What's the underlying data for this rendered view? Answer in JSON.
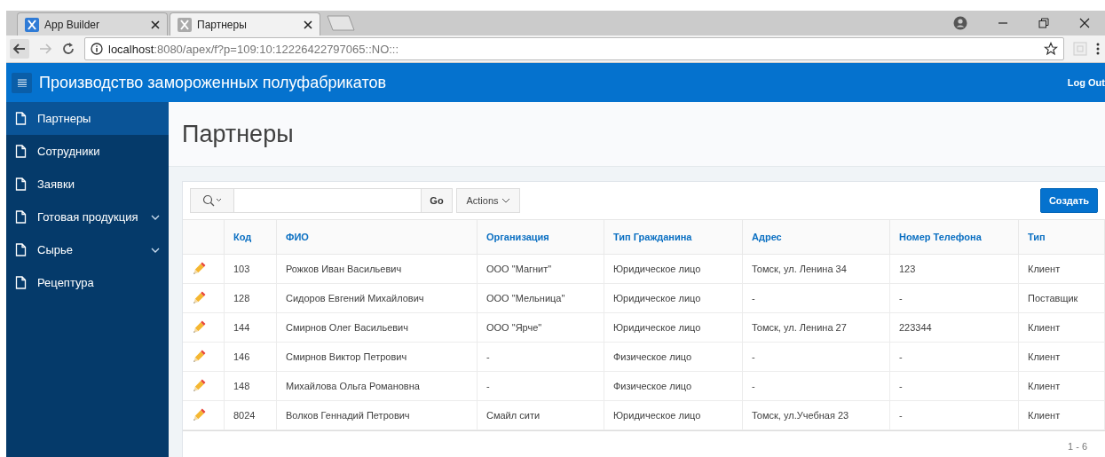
{
  "browser": {
    "tabs": [
      {
        "title": "App Builder",
        "selected": false
      },
      {
        "title": "Партнеры",
        "selected": true
      }
    ],
    "url": {
      "host": "localhost",
      "rest": ":8080/apex/f?p=109:10:12226422797065::NO:::"
    }
  },
  "app": {
    "title": "Производство замороженных полуфабрикатов",
    "logout": "Log Out"
  },
  "sidebar": {
    "items": [
      {
        "label": "Партнеры",
        "selected": true,
        "has_children": false
      },
      {
        "label": "Сотрудники",
        "selected": false,
        "has_children": false
      },
      {
        "label": "Заявки",
        "selected": false,
        "has_children": false
      },
      {
        "label": "Готовая продукция",
        "selected": false,
        "has_children": true
      },
      {
        "label": "Сырье",
        "selected": false,
        "has_children": true
      },
      {
        "label": "Рецептура",
        "selected": false,
        "has_children": false
      }
    ]
  },
  "page": {
    "title": "Партнеры"
  },
  "toolbar": {
    "go": "Go",
    "actions": "Actions",
    "create": "Создать"
  },
  "table": {
    "columns": [
      "Код",
      "ФИО",
      "Организация",
      "Тип Гражданина",
      "Адрес",
      "Номер Телефона",
      "Тип"
    ],
    "rows": [
      [
        "103",
        "Рожков Иван Васильевич",
        "ООО \"Магнит\"",
        "Юридическое лицо",
        "Томск, ул. Ленина 34",
        "123",
        "Клиент"
      ],
      [
        "128",
        "Сидоров Евгений Михайлович",
        "ООО \"Мельница\"",
        "Юридическое лицо",
        "-",
        "-",
        "Поставщик"
      ],
      [
        "144",
        "Смирнов Олег Васильевич",
        "ООО \"Ярче\"",
        "Юридическое лицо",
        "Томск, ул. Ленина 27",
        "223344",
        "Клиент"
      ],
      [
        "146",
        "Смирнов Виктор Петрович",
        "-",
        "Физическое лицо",
        "-",
        "-",
        "Клиент"
      ],
      [
        "148",
        "Михайлова Ольга Романовна",
        "-",
        "Физическое лицо",
        "-",
        "-",
        "Клиент"
      ],
      [
        "8024",
        "Волков Геннадий Петрович",
        "Смайл сити",
        "Юридическое лицо",
        "Томск, ул.Учебная 23",
        "-",
        "Клиент"
      ]
    ]
  },
  "pagination": "1 - 6"
}
